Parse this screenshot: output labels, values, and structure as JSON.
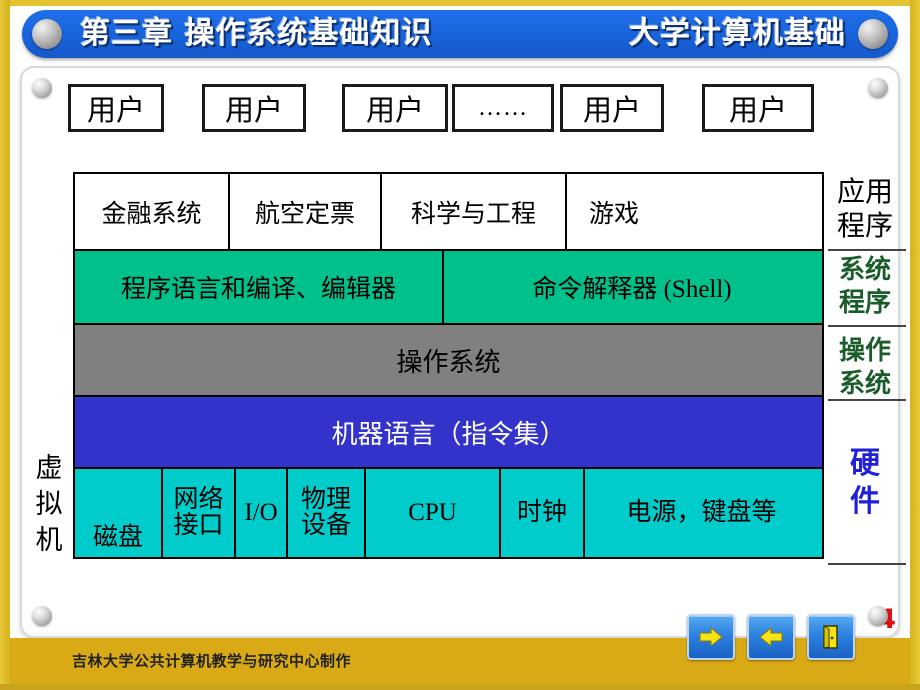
{
  "header": {
    "chapter_title": "第三章 操作系统基础知识",
    "course_title": "大学计算机基础",
    "left_ball_icon": "sphere-decoration",
    "right_ball_icon": "sphere-decoration"
  },
  "diagram": {
    "users": [
      {
        "label": "用户"
      },
      {
        "label": "用户"
      },
      {
        "label": "用户"
      },
      {
        "label": "……"
      },
      {
        "label": "用户"
      },
      {
        "label": "用户"
      }
    ],
    "applications": [
      "金融系统",
      "航空定票",
      "科学与工程",
      "游戏"
    ],
    "system_programs": [
      "程序语言和编译、编辑器",
      "命令解释器 (Shell)"
    ],
    "operating_system": "操作系统",
    "machine_language": "机器语言（指令集）",
    "hardware": [
      "磁盘",
      "网络接口",
      "I/O",
      "物理设备",
      "CPU",
      "时钟",
      "电源，键盘等"
    ],
    "hardware_lines": [
      [
        "磁盘"
      ],
      [
        "网络",
        "接口"
      ],
      [
        "I/O"
      ],
      [
        "物理",
        "设备"
      ],
      [
        "CPU"
      ],
      [
        "时钟"
      ],
      [
        "电源，键盘等"
      ]
    ],
    "virtual_machine_label": [
      "虚",
      "拟",
      "机"
    ],
    "right_labels": {
      "applications": [
        "应用",
        "程序"
      ],
      "system_programs": [
        "系统",
        "程序"
      ],
      "operating_system": [
        "操作",
        "系统"
      ],
      "hardware": [
        "硬",
        "件"
      ]
    }
  },
  "colors": {
    "frame": "#e3c331",
    "header_bar": "#1a65dd",
    "system_programs_row": "#00C08C",
    "operating_system_row": "#808080",
    "machine_language_row": "#3333CC",
    "hardware_row": "#00CCCC",
    "footer": "#d9aa15",
    "right_label_green": "#1a5c2a",
    "right_label_blue": "#2020d8",
    "page_number": "#e01010"
  },
  "footer": {
    "credit": "吉林大学公共计算机教学与研究中心制作",
    "page_number": "4",
    "buttons": [
      {
        "name": "next-slide-button",
        "icon": "arrow-right-icon"
      },
      {
        "name": "previous-slide-button",
        "icon": "arrow-left-icon"
      },
      {
        "name": "exit-button",
        "icon": "exit-door-icon"
      }
    ]
  }
}
